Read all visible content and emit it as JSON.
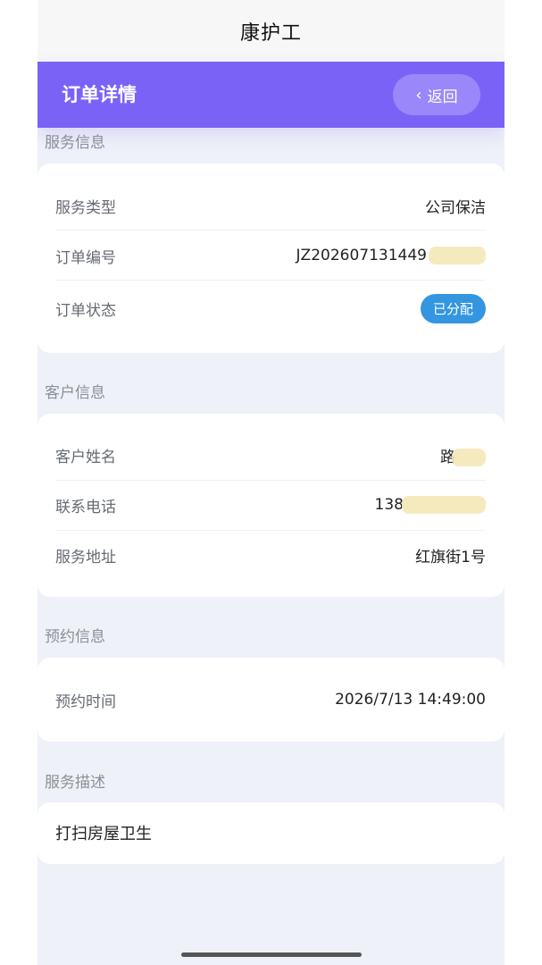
{
  "app": {
    "title": "康护工"
  },
  "header": {
    "title": "订单详情",
    "back_label": "返回"
  },
  "sections": {
    "service": {
      "label": "服务信息",
      "rows": [
        {
          "label": "服务类型",
          "value": "公司保洁"
        },
        {
          "label": "订单编号",
          "value": "JZ202607131449"
        },
        {
          "label": "订单状态",
          "value": "已分配"
        }
      ]
    },
    "customer": {
      "label": "客户信息",
      "rows": [
        {
          "label": "客户姓名",
          "value": "路"
        },
        {
          "label": "联系电话",
          "value": "138"
        },
        {
          "label": "服务地址",
          "value": "红旗街1号"
        }
      ]
    },
    "appointment": {
      "label": "预约信息",
      "rows": [
        {
          "label": "预约时间",
          "value": "2026/7/13 14:49:00"
        }
      ]
    },
    "description": {
      "label": "服务描述",
      "text": "打扫房屋卫生"
    }
  },
  "colors": {
    "header_bg": "#7b62f7",
    "status_badge": "#3496e0",
    "page_bg": "#eef1f8"
  },
  "icons": {
    "back": "chevron-left-icon"
  }
}
